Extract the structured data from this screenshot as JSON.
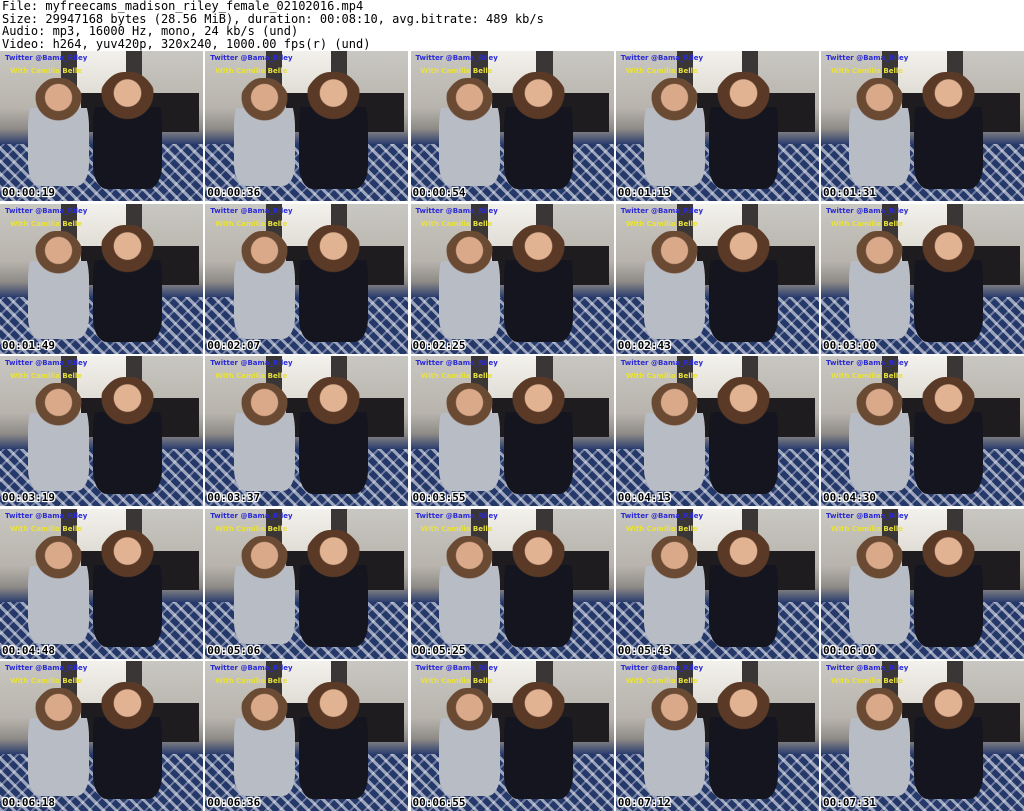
{
  "header": {
    "file": "File: myfreecams_madison_riley_female_02102016.mp4",
    "size": "Size: 29947168 bytes (28.56 MiB), duration: 00:08:10, avg.bitrate: 489 kb/s",
    "audio": "Audio: mp3, 16000 Hz, mono, 24 kb/s (und)",
    "video": "Video: h264, yuv420p, 320x240, 1000.00 fps(r) (und)"
  },
  "overlay": {
    "line1": "Twitter @Bama_Riley",
    "line2": "With Camilia Belle"
  },
  "thumbnails": [
    {
      "time": "00:00:19"
    },
    {
      "time": "00:00:36"
    },
    {
      "time": "00:00:54"
    },
    {
      "time": "00:01:13"
    },
    {
      "time": "00:01:31"
    },
    {
      "time": "00:01:49"
    },
    {
      "time": "00:02:07"
    },
    {
      "time": "00:02:25"
    },
    {
      "time": "00:02:43"
    },
    {
      "time": "00:03:00"
    },
    {
      "time": "00:03:19"
    },
    {
      "time": "00:03:37"
    },
    {
      "time": "00:03:55"
    },
    {
      "time": "00:04:13"
    },
    {
      "time": "00:04:30"
    },
    {
      "time": "00:04:48"
    },
    {
      "time": "00:05:06"
    },
    {
      "time": "00:05:25"
    },
    {
      "time": "00:05:43"
    },
    {
      "time": "00:06:00"
    },
    {
      "time": "00:06:18"
    },
    {
      "time": "00:06:36"
    },
    {
      "time": "00:06:55"
    },
    {
      "time": "00:07:12"
    },
    {
      "time": "00:07:31"
    }
  ]
}
